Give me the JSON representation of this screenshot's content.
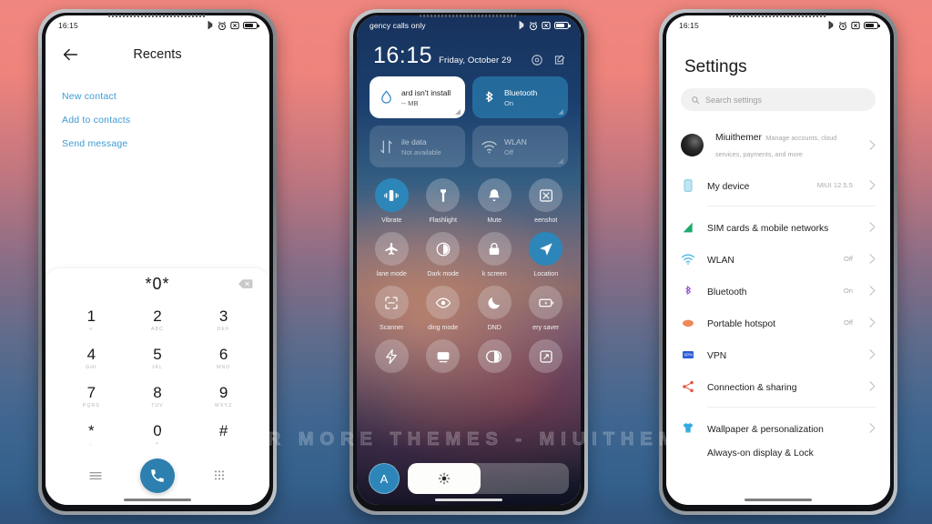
{
  "background": {
    "top_color": "#f0877f",
    "mid_color": "#8a6d86",
    "bottom_color": "#2f537c"
  },
  "watermark": {
    "text": "VISIT FOR MORE THEMES - MIUITHEMER.COM"
  },
  "phone1": {
    "status": {
      "time": "16:15",
      "icons": [
        "bluetooth-icon",
        "alarm-icon",
        "silent-icon",
        "battery-icon"
      ]
    },
    "header": {
      "back": "back-arrow",
      "title": "Recents"
    },
    "links": [
      {
        "label": "New contact"
      },
      {
        "label": "Add to contacts"
      },
      {
        "label": "Send message"
      }
    ],
    "dialer": {
      "number": "*0*",
      "delete": "backspace-icon",
      "keys": [
        {
          "digit": "1",
          "sub": "∞"
        },
        {
          "digit": "2",
          "sub": "ABC"
        },
        {
          "digit": "3",
          "sub": "DEF"
        },
        {
          "digit": "4",
          "sub": "GHI"
        },
        {
          "digit": "5",
          "sub": "JKL"
        },
        {
          "digit": "6",
          "sub": "MNO"
        },
        {
          "digit": "7",
          "sub": "PQRS"
        },
        {
          "digit": "8",
          "sub": "TUV"
        },
        {
          "digit": "9",
          "sub": "WXYZ"
        },
        {
          "digit": "*",
          "sub": ","
        },
        {
          "digit": "0",
          "sub": "+"
        },
        {
          "digit": "#",
          "sub": ""
        }
      ]
    },
    "bottom_bar": {
      "left_icon": "menu-icon",
      "call_icon": "phone-call-icon",
      "right_icon": "keypad-icon",
      "accent": "#2c7fae"
    }
  },
  "phone2": {
    "status": {
      "carrier": "gency calls only",
      "icons": [
        "bluetooth-icon",
        "alarm-icon",
        "silent-icon",
        "battery-icon"
      ]
    },
    "clock": {
      "time": "16:15",
      "date": "Friday, October 29"
    },
    "header_icons": [
      "settings-gear-icon",
      "edit-icon"
    ],
    "tiles": [
      {
        "name": "sd-card",
        "title": "ard isn't install",
        "subtitle": "-- MB",
        "state": "white",
        "icon": "water-drop-icon"
      },
      {
        "name": "bluetooth",
        "title": "Bluetooth",
        "subtitle": "On",
        "state": "on",
        "icon": "bluetooth-icon"
      },
      {
        "name": "mobile-data",
        "title": "ile data",
        "subtitle": "Not available",
        "state": "off",
        "icon": "data-arrows-icon"
      },
      {
        "name": "wlan",
        "title": "WLAN",
        "subtitle": "Off",
        "state": "off",
        "icon": "wifi-icon"
      }
    ],
    "toggles": [
      {
        "label": "Vibrate",
        "icon": "vibrate-icon",
        "active": true
      },
      {
        "label": "Flashlight",
        "icon": "flashlight-icon",
        "active": false
      },
      {
        "label": "Mute",
        "icon": "bell-icon",
        "active": false
      },
      {
        "label": "eenshot",
        "icon": "screenshot-icon",
        "active": false
      },
      {
        "label": "lane mode",
        "icon": "airplane-icon",
        "active": false
      },
      {
        "label": "Dark mode",
        "icon": "dark-mode-icon",
        "active": false
      },
      {
        "label": "k screen",
        "icon": "lock-icon",
        "active": false
      },
      {
        "label": "Location",
        "icon": "location-arrow-icon",
        "active": true
      },
      {
        "label": "Scanner",
        "icon": "scan-frame-icon",
        "active": false
      },
      {
        "label": "ding mode",
        "icon": "eye-icon",
        "active": false
      },
      {
        "label": "DND",
        "icon": "moon-icon",
        "active": false
      },
      {
        "label": "ery saver",
        "icon": "battery-saver-icon",
        "active": false
      },
      {
        "label": "",
        "icon": "lightning-icon",
        "active": false
      },
      {
        "label": "",
        "icon": "cast-screen-icon",
        "active": false
      },
      {
        "label": "",
        "icon": "contrast-icon",
        "active": false
      },
      {
        "label": "",
        "icon": "expand-icon",
        "active": false
      }
    ],
    "brightness": {
      "auto_label": "A",
      "icon": "sun-icon",
      "level_percent": 45
    }
  },
  "phone3": {
    "status": {
      "time": "16:15",
      "icons": [
        "bluetooth-icon",
        "alarm-icon",
        "silent-icon",
        "battery-icon"
      ]
    },
    "title": "Settings",
    "search": {
      "placeholder": "Search settings",
      "icon": "search-icon"
    },
    "account": {
      "name": "Miuithemer",
      "subtitle": "Manage accounts, cloud services, payments, and more",
      "avatar": "user-avatar"
    },
    "items": [
      {
        "label": "My device",
        "value": "MIUI 12.5.5",
        "icon": "device-icon",
        "color": "#8fd3e8"
      },
      {
        "label": "SIM cards & mobile networks",
        "value": "",
        "icon": "signal-icon",
        "color": "#25a36f"
      },
      {
        "label": "WLAN",
        "value": "Off",
        "icon": "wifi-icon",
        "color": "#4db6e8"
      },
      {
        "label": "Bluetooth",
        "value": "On",
        "icon": "bluetooth-icon",
        "color": "#a05fd6"
      },
      {
        "label": "Portable hotspot",
        "value": "Off",
        "icon": "hotspot-icon",
        "color": "#f08a5d"
      },
      {
        "label": "VPN",
        "value": "",
        "icon": "vpn-icon",
        "color": "#2d5bd7"
      },
      {
        "label": "Connection & sharing",
        "value": "",
        "icon": "share-icon",
        "color": "#e8503a"
      }
    ],
    "items2": [
      {
        "label": "Wallpaper & personalization",
        "value": "",
        "icon": "shirt-icon",
        "color": "#35a8e0"
      },
      {
        "label": "Always-on display & Lock",
        "value": "",
        "icon": "lock-screen-icon",
        "color": "#6a6a6a"
      }
    ]
  }
}
